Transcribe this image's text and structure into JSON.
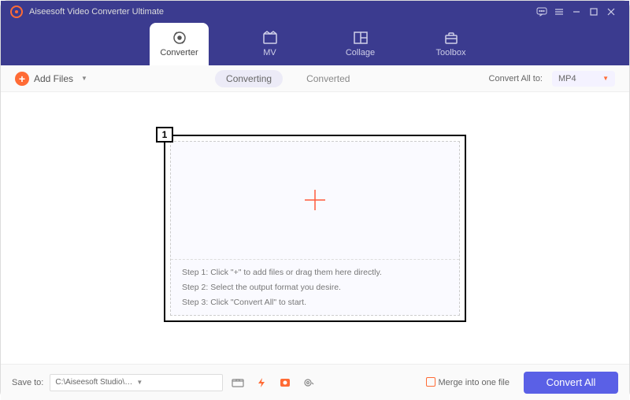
{
  "app_title": "Aiseesoft Video Converter Ultimate",
  "tabs": [
    "Converter",
    "MV",
    "Collage",
    "Toolbox"
  ],
  "toolbar": {
    "add_files": "Add Files",
    "center_tabs": [
      "Converting",
      "Converted"
    ],
    "convert_all_to": "Convert All to:",
    "format": "MP4"
  },
  "callout": "1",
  "steps": [
    "Step 1: Click \"+\" to add files or drag them here directly.",
    "Step 2: Select the output format you desire.",
    "Step 3: Click \"Convert All\" to start."
  ],
  "bottom": {
    "save_to_label": "Save to:",
    "save_to_path": "C:\\Aiseesoft Studio\\Ais...rter Ultimate\\Converted",
    "merge_label": "Merge into one file",
    "convert_all": "Convert All"
  }
}
